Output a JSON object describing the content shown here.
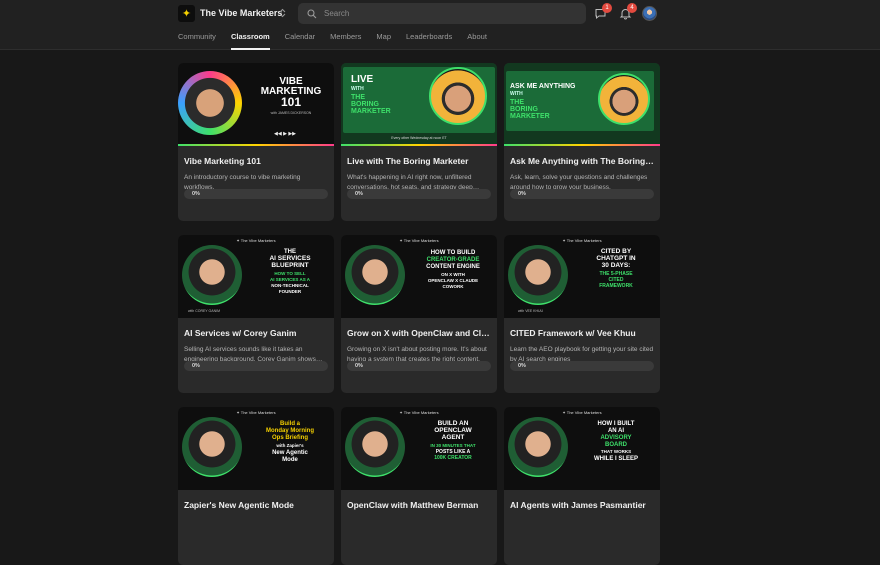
{
  "header": {
    "logo_glyph": "✦",
    "group_name": "The Vibe Marketers",
    "switcher_glyph": "⌃⌄",
    "search_placeholder": "Search",
    "chat_badge": "1",
    "notif_badge": "4"
  },
  "tabs": [
    {
      "label": "Community",
      "active": false
    },
    {
      "label": "Classroom",
      "active": true
    },
    {
      "label": "Calendar",
      "active": false
    },
    {
      "label": "Members",
      "active": false
    },
    {
      "label": "Map",
      "active": false
    },
    {
      "label": "Leaderboards",
      "active": false
    },
    {
      "label": "About",
      "active": false
    }
  ],
  "courses": [
    {
      "title": "Vibe Marketing 101",
      "description": "An introductory course to vibe marketing workflows.",
      "progress_label": "0%",
      "progress": 0,
      "thumb": {
        "line1": "VIBE",
        "line2": "MARKETING",
        "line3": "101",
        "byline": "with JAMES DICKERSON"
      }
    },
    {
      "title": "Live with The Boring Marketer",
      "description": "What's happening in AI right now, unfiltered conversations, hot seats, and strategy deep dives.",
      "progress_label": "0%",
      "progress": 0,
      "thumb": {
        "line1": "LIVE",
        "line2": "WITH",
        "line3": "THE",
        "line4": "BORING",
        "line5": "MARKETER",
        "byline": "Every other Wednesday at noon ET"
      }
    },
    {
      "title": "Ask Me Anything with The Boring Marketer",
      "description": "Ask, learn, solve your questions and challenges around how to grow your business.",
      "progress_label": "0%",
      "progress": 0,
      "thumb": {
        "line1": "ASK ME ANYTHING",
        "line2": "WITH",
        "line3": "THE",
        "line4": "BORING",
        "line5": "MARKETER"
      }
    },
    {
      "title": "AI Services w/ Corey Ganim",
      "description": "Selling AI services sounds like it takes an engineering background. Corey Ganim shows how to do it without one.",
      "progress_label": "0%",
      "progress": 0,
      "thumb": {
        "head": "✦ The Vibe Marketers",
        "line1": "THE",
        "line2": "AI SERVICES",
        "line3": "BLUEPRINT",
        "line4": "HOW TO SELL",
        "line5": "AI SERVICES AS A",
        "line6": "NON-TECHNICAL",
        "line7": "FOUNDER",
        "byline": "with COREY GANIM"
      }
    },
    {
      "title": "Grow on X with OpenClaw and Claude Cowork",
      "description": "Growing on X isn't about posting more. It's about having a system that creates the right content.",
      "progress_label": "0%",
      "progress": 0,
      "thumb": {
        "head": "✦ The Vibe Marketers",
        "line1": "HOW TO BUILD",
        "line2": "CREATOR-GRADE",
        "line3": "CONTENT ENGINE",
        "line4": "ON X WITH",
        "line5": "OPENCLAW X CLAUDE",
        "line6": "COWORK"
      }
    },
    {
      "title": "CITED Framework w/ Vee Khuu",
      "description": "Learn the AEO playbook for getting your site cited by AI search engines",
      "progress_label": "0%",
      "progress": 0,
      "thumb": {
        "head": "✦ The Vibe Marketers",
        "line1": "CITED BY",
        "line2": "CHATGPT IN",
        "line3": "30 DAYS:",
        "line4": "THE 5-PHASE",
        "line5": "CITED",
        "line6": "FRAMEWORK",
        "byline": "with VEE KHUU"
      }
    },
    {
      "title": "Zapier's New Agentic Mode",
      "description": "",
      "progress_label": "0%",
      "progress": 0,
      "thumb": {
        "head": "✦ The Vibe Marketers",
        "line1": "Build a",
        "line2": "Monday Morning",
        "line3": "Ops Briefing",
        "line4": "with Zapier's",
        "line5": "New Agentic",
        "line6": "Mode"
      }
    },
    {
      "title": "OpenClaw with Matthew Berman",
      "description": "",
      "progress_label": "0%",
      "progress": 0,
      "thumb": {
        "head": "✦ The Vibe Marketers",
        "line1": "BUILD AN",
        "line2": "OPENCLAW",
        "line3": "AGENT",
        "line4": "IN 30 MINUTES THAT",
        "line5": "POSTS LIKE A",
        "line6": "100K CREATOR"
      }
    },
    {
      "title": "AI Agents with James Pasmantier",
      "description": "",
      "progress_label": "0%",
      "progress": 0,
      "thumb": {
        "head": "✦ The Vibe Marketers",
        "line1": "HOW I BUILT",
        "line2": "AN AI",
        "line3": "ADVISORY",
        "line4": "BOARD",
        "line5": "THAT WORKS",
        "line6": "WHILE I SLEEP"
      }
    }
  ],
  "colors": {
    "accent_green": "#3ee06a",
    "accent_yellow": "#f5d000",
    "badge_red": "#e34a3f"
  }
}
